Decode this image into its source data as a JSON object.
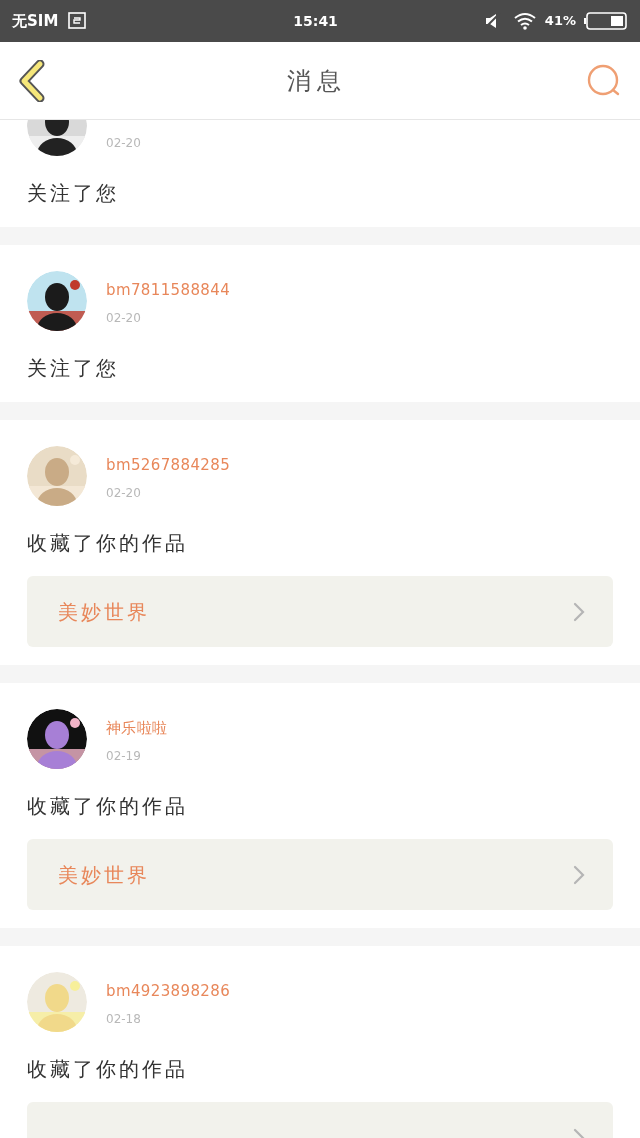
{
  "status_bar": {
    "carrier": "无SIM",
    "time": "15:41",
    "battery": "41%"
  },
  "header": {
    "title": "消息"
  },
  "messages": [
    {
      "kind": "follow",
      "date": "02-20",
      "action": "关注了您",
      "scrolled": true
    },
    {
      "kind": "follow",
      "name": "bm7811588844",
      "date": "02-20",
      "action": "关注了您"
    },
    {
      "kind": "favorite",
      "name": "bm5267884285",
      "date": "02-20",
      "action": "收藏了你的作品",
      "work_title": "美妙世界"
    },
    {
      "kind": "favorite",
      "name": "神乐啦啦",
      "date": "02-19",
      "action": "收藏了你的作品",
      "work_title": "美妙世界"
    },
    {
      "kind": "favorite",
      "name": "bm4923898286",
      "date": "02-18",
      "action": "收藏了你的作品"
    }
  ]
}
